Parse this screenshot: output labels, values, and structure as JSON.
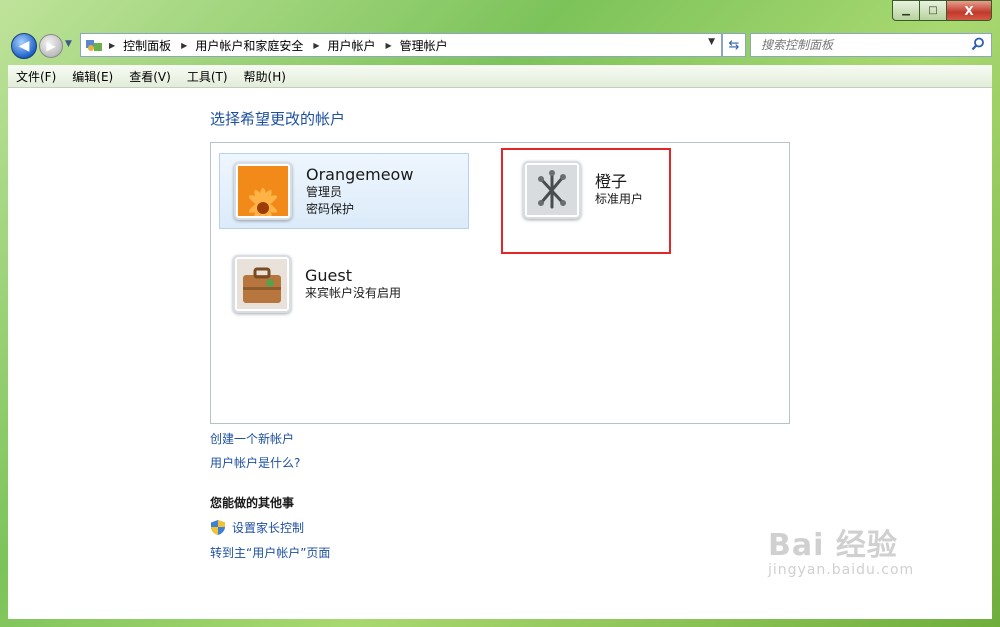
{
  "window": {
    "caption": {
      "minimize": "▁",
      "maximize": "□",
      "close": "X"
    }
  },
  "nav": {
    "back_icon": "back-arrow-icon",
    "forward_icon": "forward-arrow-icon",
    "breadcrumb": [
      "控制面板",
      "用户帐户和家庭安全",
      "用户帐户",
      "管理帐户"
    ],
    "search_placeholder": "搜索控制面板"
  },
  "menu": [
    "文件(F)",
    "编辑(E)",
    "查看(V)",
    "工具(T)",
    "帮助(H)"
  ],
  "page": {
    "title": "选择希望更改的帐户",
    "accounts": [
      {
        "name": "Orangemeow",
        "role": "管理员",
        "status": "密码保护",
        "picture": "orange-flower-picture"
      },
      {
        "name": "橙子",
        "role": "标准用户",
        "picture": "silver-jacks-picture"
      },
      {
        "name": "Guest",
        "role": "来宾帐户没有启用",
        "picture": "suitcase-picture"
      }
    ],
    "links": {
      "create_account": "创建一个新帐户",
      "what_is_account": "用户帐户是什么?"
    },
    "other_section_title": "您能做的其他事",
    "other_tasks": {
      "parental_controls": "设置家长控制",
      "main_accounts_page": "转到主“用户帐户”页面"
    }
  },
  "watermark": {
    "main": "Bai 经验",
    "sub": "jingyan.baidu.com"
  },
  "colors": {
    "link": "#1e50a2",
    "highlight": "#e3262a",
    "selected_bg": "#dcebfa"
  }
}
